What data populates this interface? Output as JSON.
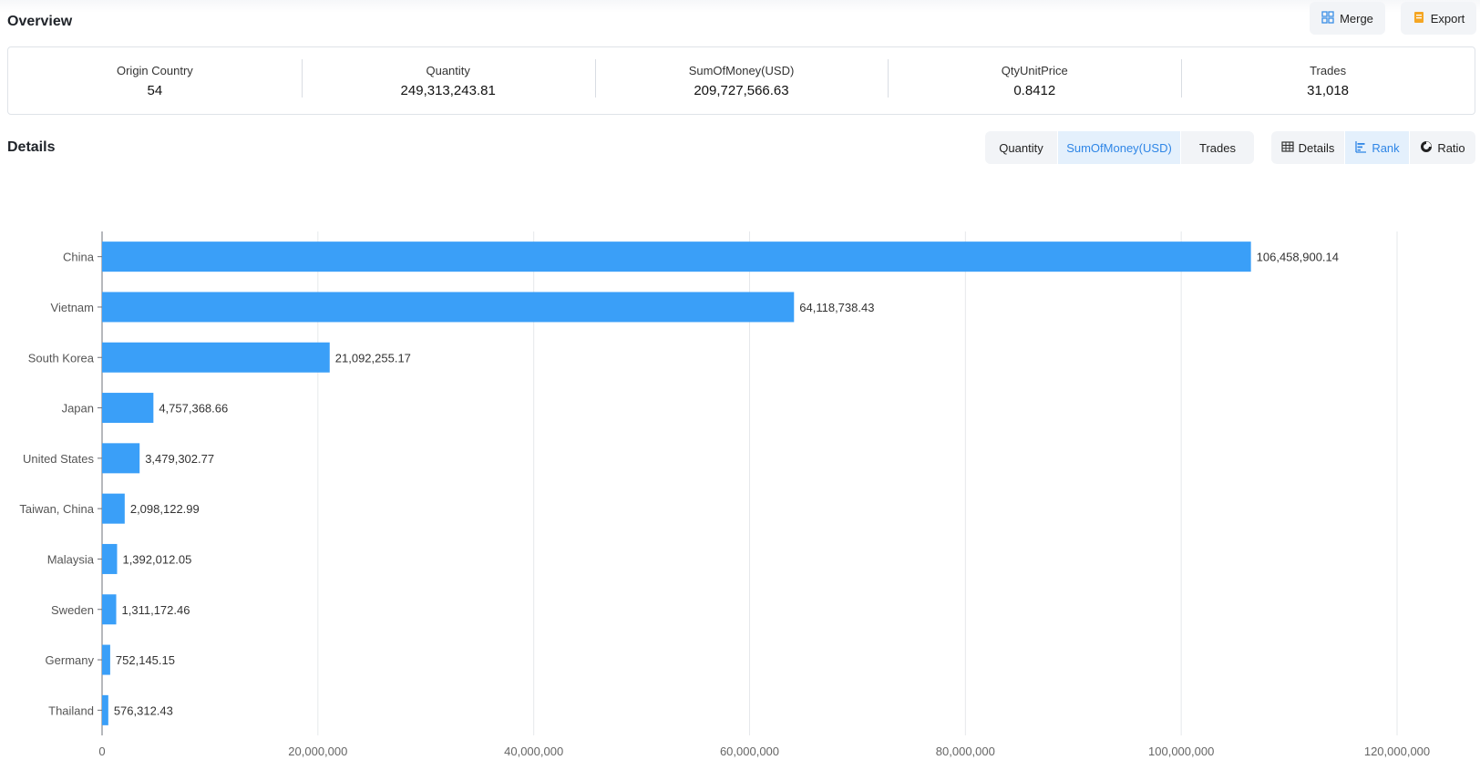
{
  "overview": {
    "title": "Overview",
    "merge_label": "Merge",
    "export_label": "Export",
    "stats": [
      {
        "label": "Origin Country",
        "value": "54"
      },
      {
        "label": "Quantity",
        "value": "249,313,243.81"
      },
      {
        "label": "SumOfMoney(USD)",
        "value": "209,727,566.63"
      },
      {
        "label": "QtyUnitPrice",
        "value": "0.8412"
      },
      {
        "label": "Trades",
        "value": "31,018"
      }
    ]
  },
  "details": {
    "title": "Details",
    "metric_tabs": [
      "Quantity",
      "SumOfMoney(USD)",
      "Trades"
    ],
    "metric_active": "SumOfMoney(USD)",
    "view_tabs": [
      {
        "label": "Details",
        "icon": "table-icon"
      },
      {
        "label": "Rank",
        "icon": "bar-rank-icon"
      },
      {
        "label": "Ratio",
        "icon": "donut-icon"
      }
    ],
    "view_active": "Rank"
  },
  "colors": {
    "accent": "#2f86e6",
    "bar": "#3a9ff8",
    "merge_icon": "#3a8ee6",
    "export_icon": "#f5a623"
  },
  "chart_data": {
    "type": "bar",
    "orientation": "horizontal",
    "categories": [
      "China",
      "Vietnam",
      "South Korea",
      "Japan",
      "United States",
      "Taiwan, China",
      "Malaysia",
      "Sweden",
      "Germany",
      "Thailand"
    ],
    "values": [
      106458900.14,
      64118738.43,
      21092255.17,
      4757368.66,
      3479302.77,
      2098122.99,
      1392012.05,
      1311172.46,
      752145.15,
      576312.43
    ],
    "value_labels": [
      "106,458,900.14",
      "64,118,738.43",
      "21,092,255.17",
      "4,757,368.66",
      "3,479,302.77",
      "2,098,122.99",
      "1,392,012.05",
      "1,311,172.46",
      "752,145.15",
      "576,312.43"
    ],
    "xlim": [
      0,
      120000000
    ],
    "xticks": [
      0,
      20000000,
      40000000,
      60000000,
      80000000,
      100000000,
      120000000
    ],
    "xtick_labels": [
      "0",
      "20,000,000",
      "40,000,000",
      "60,000,000",
      "80,000,000",
      "100,000,000",
      "120,000,000"
    ],
    "grid": "vertical",
    "title": "",
    "xlabel": "",
    "ylabel": ""
  }
}
